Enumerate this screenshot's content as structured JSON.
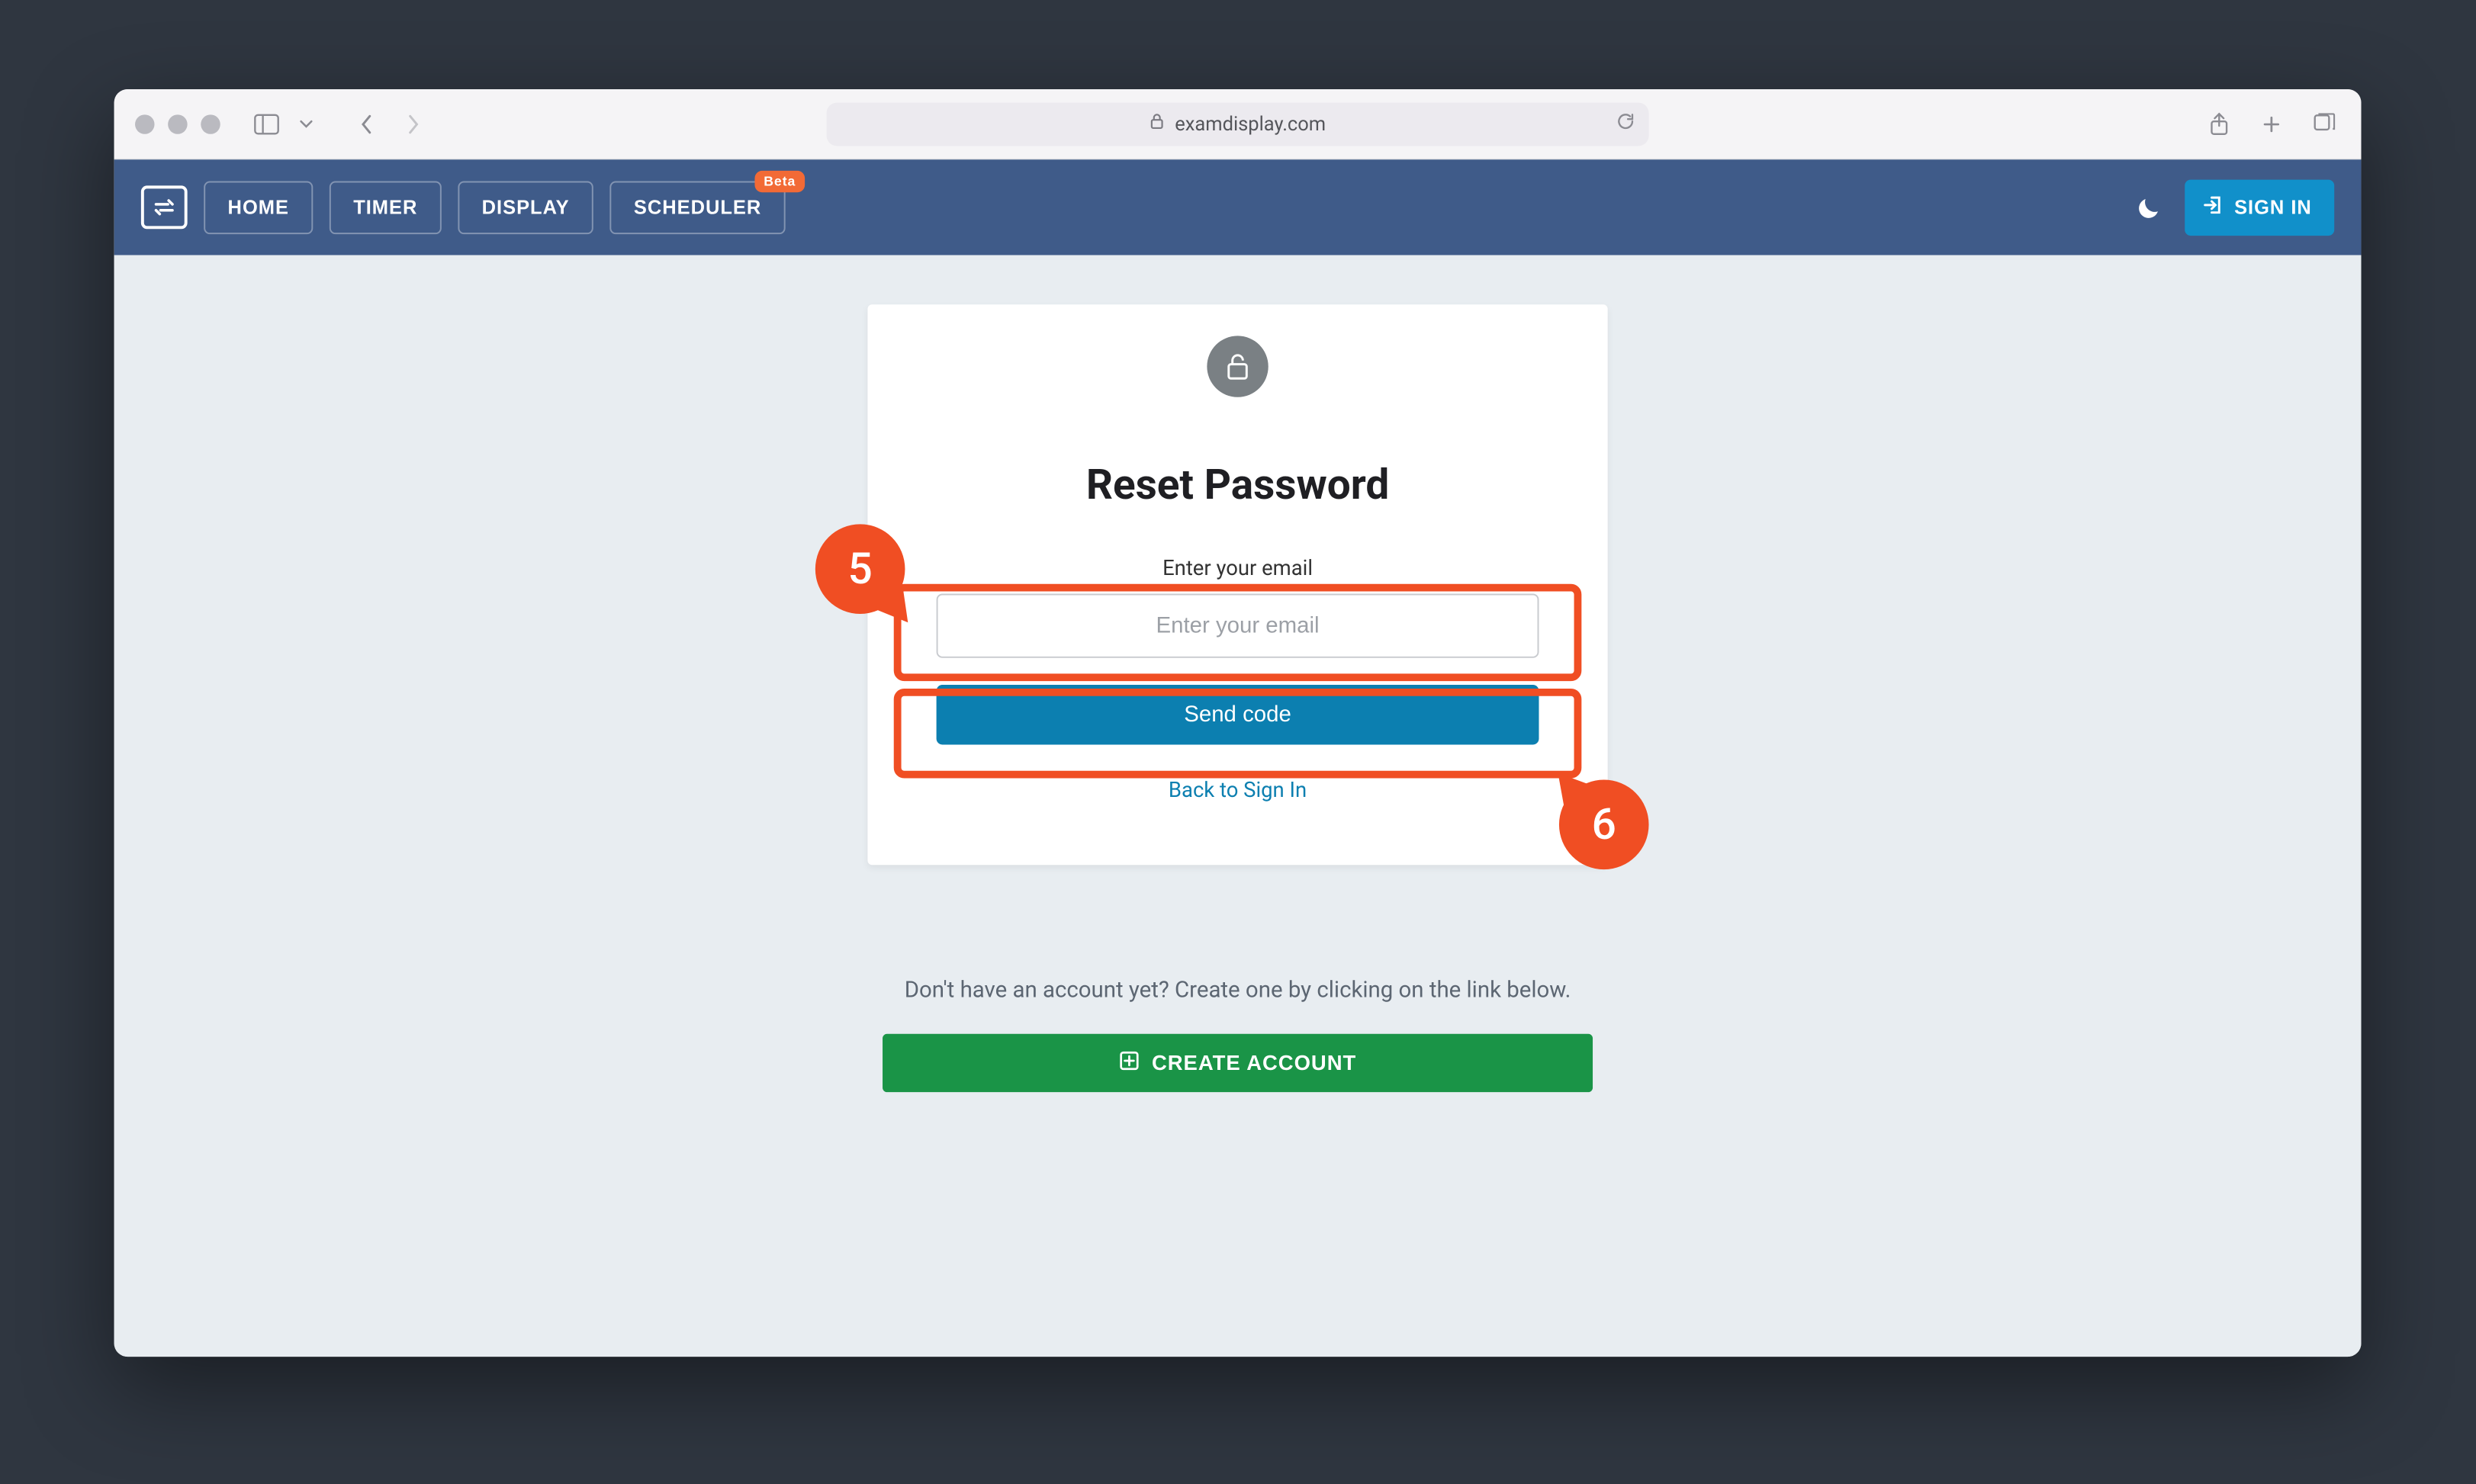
{
  "browser": {
    "url_host": "examdisplay.com"
  },
  "header": {
    "nav": {
      "home": "HOME",
      "timer": "TIMER",
      "display": "DISPLAY",
      "scheduler": "SCHEDULER",
      "scheduler_badge": "Beta"
    },
    "signin_label": "SIGN IN"
  },
  "reset_card": {
    "title": "Reset Password",
    "field_label": "Enter your email",
    "email_placeholder": "Enter your email",
    "send_button": "Send code",
    "back_link": "Back to Sign In"
  },
  "create_section": {
    "prompt": "Don't have an account yet? Create one by clicking on the link below.",
    "button": "CREATE ACCOUNT"
  },
  "annotations": {
    "five": "5",
    "six": "6"
  },
  "colors": {
    "header_bg": "#3f5b89",
    "primary_blue": "#1190ca",
    "action_blue": "#0c7fb0",
    "success_green": "#1a9447",
    "annotation_orange": "#f04e23",
    "body_bg": "#e8edf1"
  }
}
